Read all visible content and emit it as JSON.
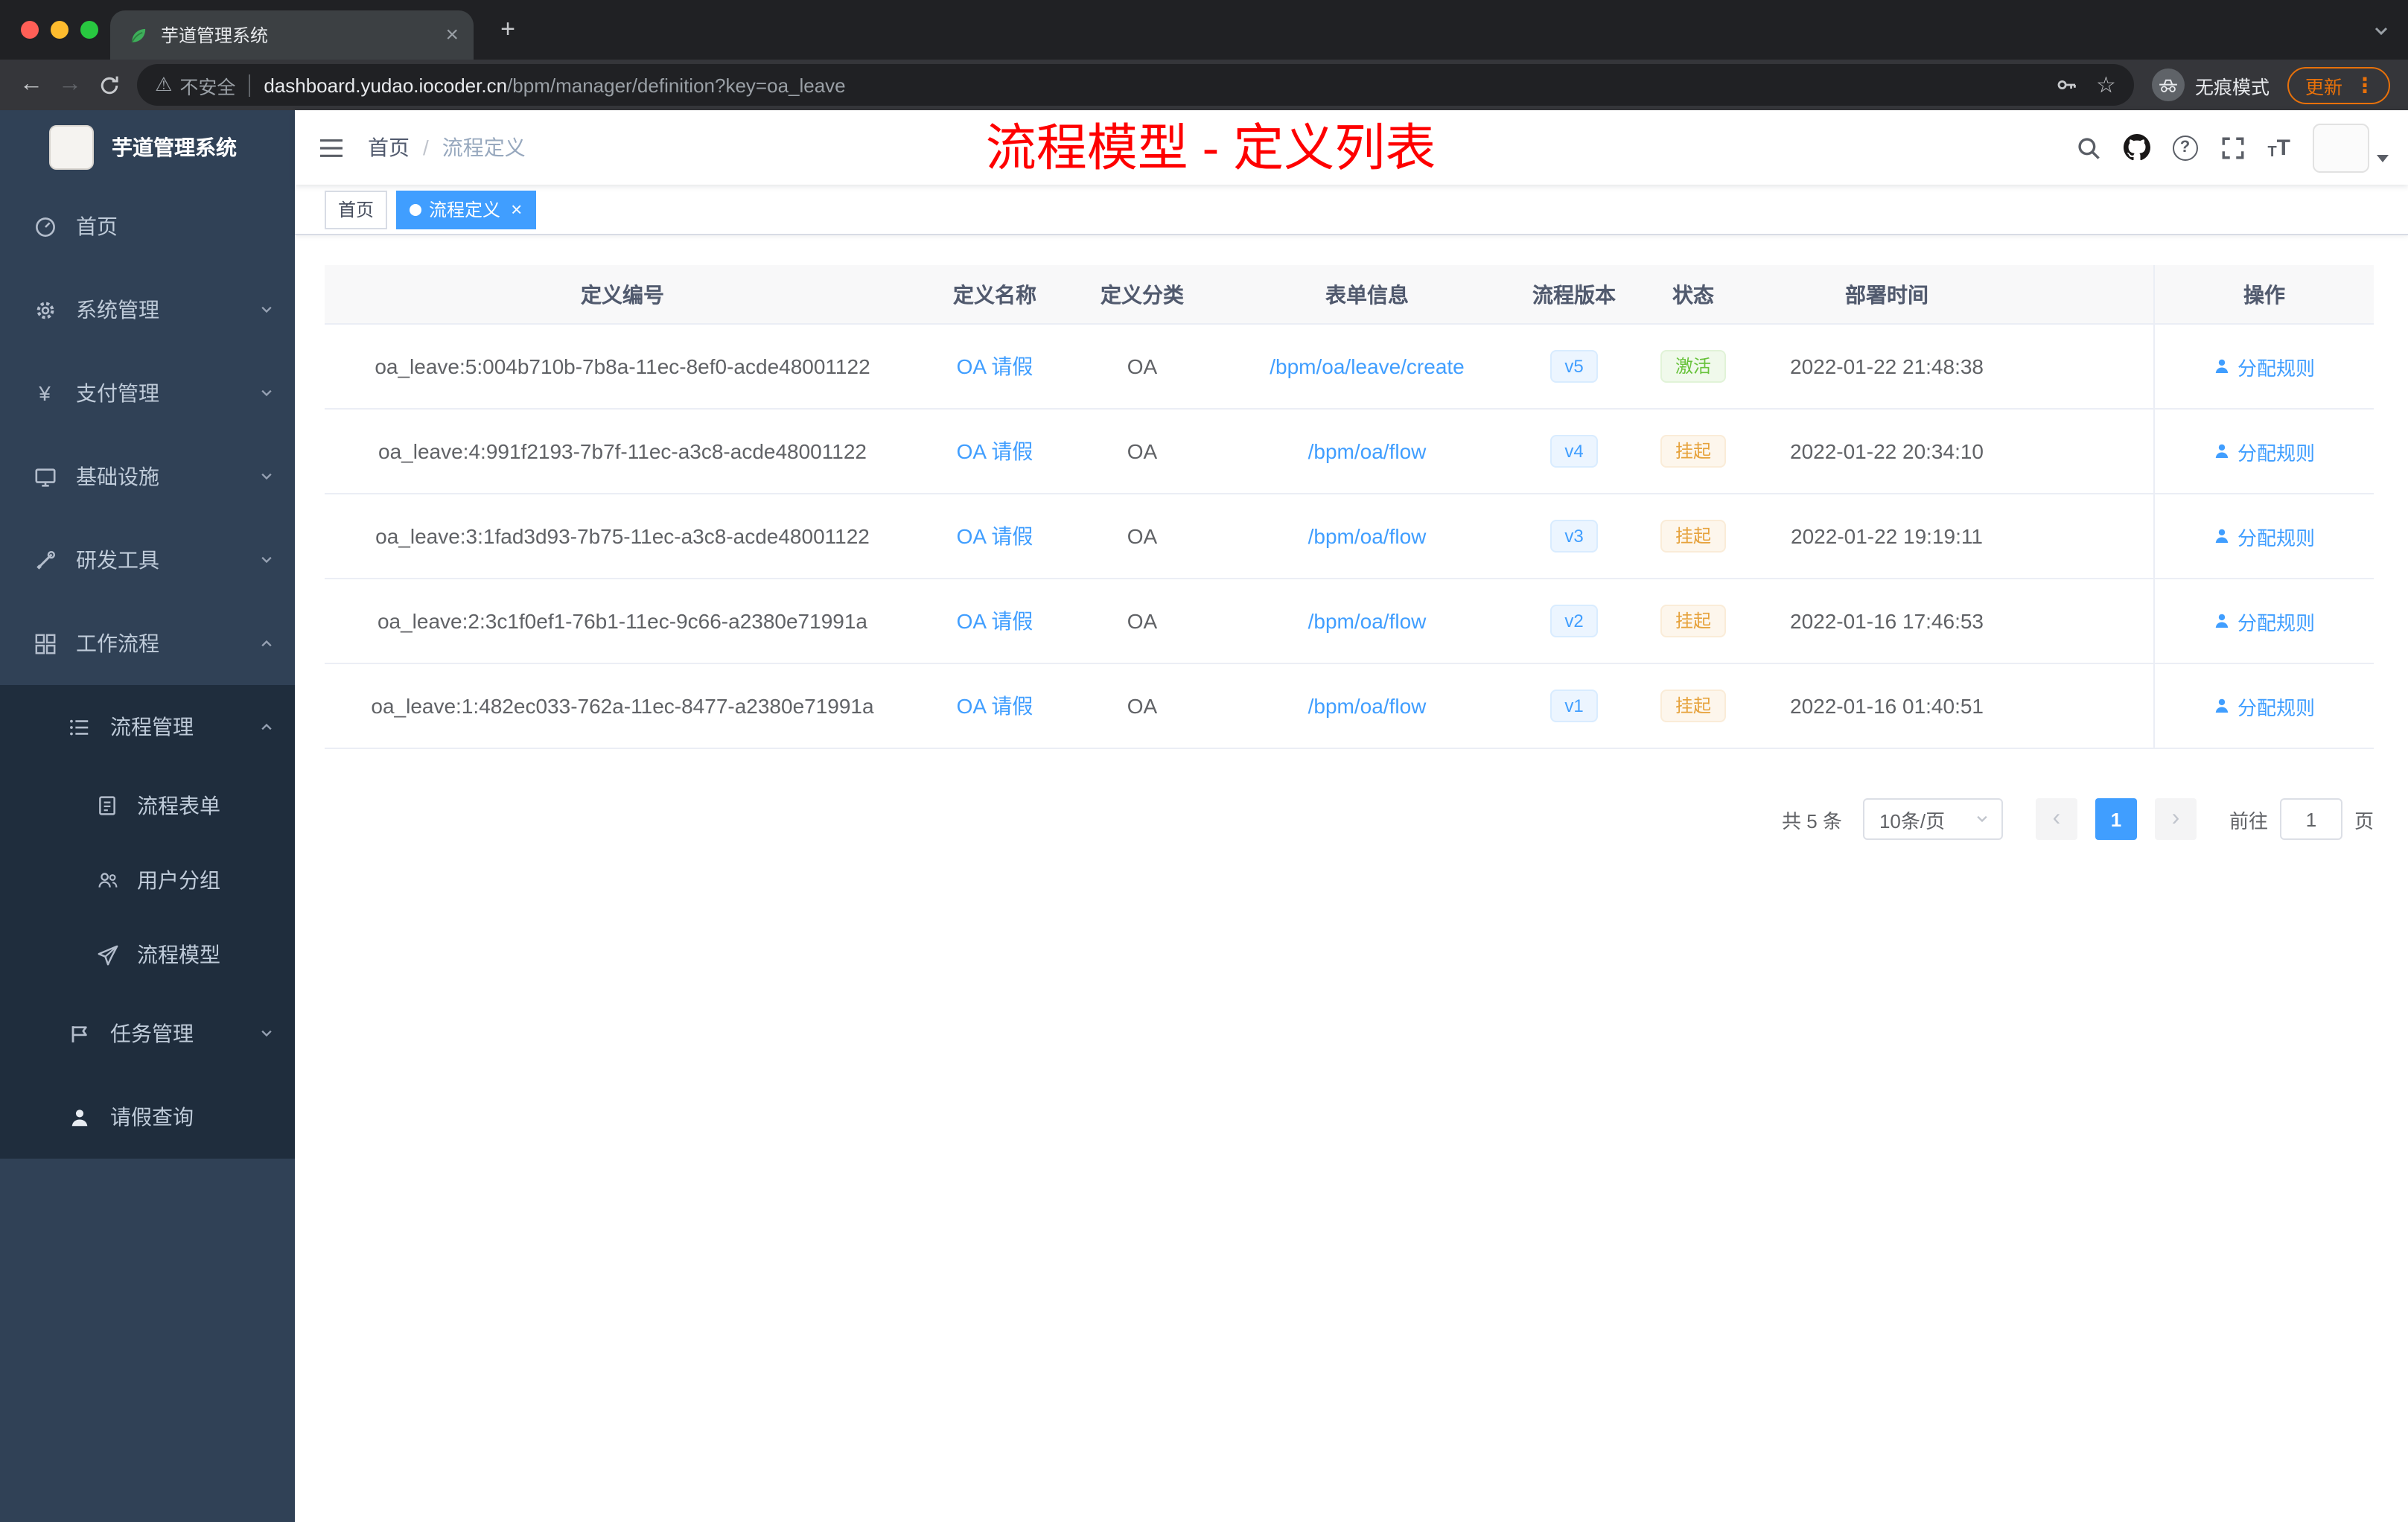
{
  "colors": {
    "accent": "#409eff",
    "success": "#67c23a",
    "warning": "#e6a23c",
    "annotation_red": "#fe0000",
    "sidebar_bg": "#304156",
    "submenu_bg": "#1f2d3d",
    "chrome_bg": "#202124"
  },
  "browser": {
    "tab_title": "芋道管理系统",
    "security_label": "不安全",
    "url_domain": "dashboard.yudao.iocoder.cn",
    "url_path": "/bpm/manager/definition?key=oa_leave",
    "incognito_label": "无痕模式",
    "update_label": "更新"
  },
  "icons": {
    "tab_close": "×",
    "new_tab": "+",
    "back": "←",
    "forward": "→",
    "warning": "⚠",
    "star": "☆",
    "menu_dots": "⋮",
    "help": "?",
    "yen": "¥",
    "prev": "‹",
    "next": "›",
    "tag_close": "×",
    "font_size": "T"
  },
  "sidebar": {
    "logo_title": "芋道管理系统",
    "items": [
      {
        "label": "首页",
        "icon": "dashboard-icon"
      },
      {
        "label": "系统管理",
        "icon": "gear-icon"
      },
      {
        "label": "支付管理",
        "icon": "yen-icon"
      },
      {
        "label": "基础设施",
        "icon": "monitor-icon"
      },
      {
        "label": "研发工具",
        "icon": "tools-icon"
      },
      {
        "label": "工作流程",
        "icon": "workflow-icon",
        "expanded": true
      }
    ],
    "workflow_children": {
      "process_mgmt": {
        "label": "流程管理",
        "expanded": true,
        "children": [
          {
            "label": "流程表单"
          },
          {
            "label": "用户分组"
          },
          {
            "label": "流程模型"
          }
        ]
      },
      "task_mgmt": {
        "label": "任务管理"
      },
      "leave_query": {
        "label": "请假查询"
      }
    }
  },
  "header": {
    "breadcrumb_home": "首页",
    "breadcrumb_sep": "/",
    "breadcrumb_current": "流程定义",
    "annotation": "流程模型 - 定义列表"
  },
  "tags": [
    {
      "label": "首页",
      "active": false
    },
    {
      "label": "流程定义",
      "active": true
    }
  ],
  "table": {
    "columns": [
      "定义编号",
      "定义名称",
      "定义分类",
      "表单信息",
      "流程版本",
      "状态",
      "部署时间",
      "操作"
    ],
    "action_label": "分配规则",
    "rows": [
      {
        "id": "oa_leave:5:004b710b-7b8a-11ec-8ef0-acde48001122",
        "name": "OA 请假",
        "category": "OA",
        "form": "/bpm/oa/leave/create",
        "version": "v5",
        "status": "激活",
        "time": "2022-01-22 21:48:38"
      },
      {
        "id": "oa_leave:4:991f2193-7b7f-11ec-a3c8-acde48001122",
        "name": "OA 请假",
        "category": "OA",
        "form": "/bpm/oa/flow",
        "version": "v4",
        "status": "挂起",
        "time": "2022-01-22 20:34:10"
      },
      {
        "id": "oa_leave:3:1fad3d93-7b75-11ec-a3c8-acde48001122",
        "name": "OA 请假",
        "category": "OA",
        "form": "/bpm/oa/flow",
        "version": "v3",
        "status": "挂起",
        "time": "2022-01-22 19:19:11"
      },
      {
        "id": "oa_leave:2:3c1f0ef1-76b1-11ec-9c66-a2380e71991a",
        "name": "OA 请假",
        "category": "OA",
        "form": "/bpm/oa/flow",
        "version": "v2",
        "status": "挂起",
        "time": "2022-01-16 17:46:53"
      },
      {
        "id": "oa_leave:1:482ec033-762a-11ec-8477-a2380e71991a",
        "name": "OA 请假",
        "category": "OA",
        "form": "/bpm/oa/flow",
        "version": "v1",
        "status": "挂起",
        "time": "2022-01-16 01:40:51"
      }
    ]
  },
  "pagination": {
    "total": "共 5 条",
    "page_size": "10条/页",
    "current_page": "1",
    "goto_label": "前往",
    "goto_value": "1",
    "unit_label": "页"
  }
}
